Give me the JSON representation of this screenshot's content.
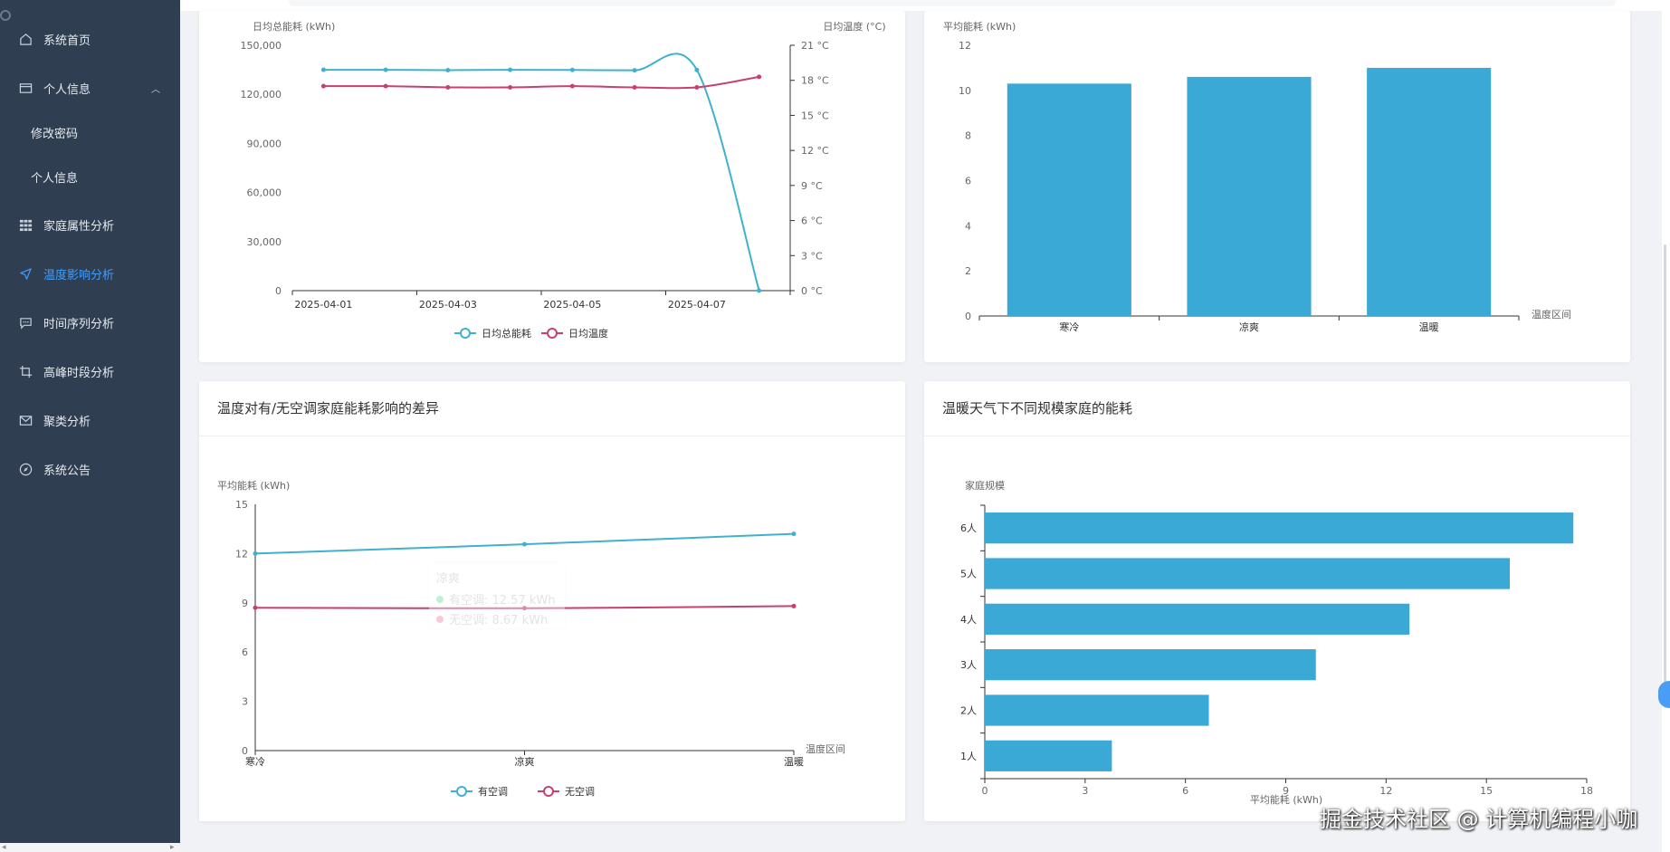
{
  "sidebar": {
    "items": [
      {
        "label": "系统首页",
        "icon": "home-icon"
      },
      {
        "label": "个人信息",
        "icon": "wallet-icon"
      },
      {
        "label": "修改密码"
      },
      {
        "label": "个人信息"
      },
      {
        "label": "家庭属性分析",
        "icon": "grid-icon"
      },
      {
        "label": "温度影响分析",
        "icon": "send-icon"
      },
      {
        "label": "时间序列分析",
        "icon": "chat-icon"
      },
      {
        "label": "高峰时段分析",
        "icon": "crop-icon"
      },
      {
        "label": "聚类分析",
        "icon": "mail-icon"
      },
      {
        "label": "系统公告",
        "icon": "compass-icon"
      }
    ],
    "active_color": "#409eff"
  },
  "cards": {
    "bottom_left_title": "温度对有/无空调家庭能耗影响的差异",
    "bottom_right_title": "温暖天气下不同规模家庭的能耗"
  },
  "tooltip": {
    "title": "凉爽",
    "row1": "有空调: 12.57 kWh",
    "row2": "无空调: 8.67 kWh"
  },
  "watermark": "掘金技术社区 @ 计算机编程小咖",
  "chart_data": [
    {
      "type": "line",
      "x": [
        "2025-04-01",
        "2025-04-02",
        "2025-04-03",
        "2025-04-04",
        "2025-04-05",
        "2025-04-06",
        "2025-04-07",
        "2025-04-08"
      ],
      "xtick_labels": [
        "2025-04-01",
        "2025-04-03",
        "2025-04-05",
        "2025-04-07"
      ],
      "series": [
        {
          "name": "日均总能耗",
          "axis": "left",
          "color": "#3fb1ce",
          "values": [
            135000,
            135000,
            134800,
            135000,
            134900,
            134700,
            134900,
            0
          ]
        },
        {
          "name": "日均温度",
          "axis": "right",
          "color": "#c8416a",
          "values": [
            17.5,
            17.5,
            17.4,
            17.4,
            17.5,
            17.4,
            17.4,
            18.3
          ]
        }
      ],
      "ylabel": "日均总能耗 (kWh)",
      "y2label": "日均温度 (°C)",
      "ylim": [
        0,
        150000
      ],
      "yticks": [
        "0",
        "30,000",
        "60,000",
        "90,000",
        "120,000",
        "150,000"
      ],
      "y2lim": [
        0,
        21
      ],
      "y2ticks": [
        "0 °C",
        "3 °C",
        "6 °C",
        "9 °C",
        "12 °C",
        "15 °C",
        "18 °C",
        "21 °C"
      ],
      "legend": "bottom"
    },
    {
      "type": "bar",
      "categories": [
        "寒冷",
        "凉爽",
        "温暖"
      ],
      "values": [
        10.3,
        10.6,
        11.0
      ],
      "color": "#3aa9d6",
      "ylabel": "平均能耗 (kWh)",
      "xlabel": "温度区间",
      "ylim": [
        0,
        12
      ],
      "yticks": [
        "0",
        "2",
        "4",
        "6",
        "8",
        "10",
        "12"
      ]
    },
    {
      "type": "line",
      "categories": [
        "寒冷",
        "凉爽",
        "温暖"
      ],
      "series": [
        {
          "name": "有空调",
          "color": "#3fb1ce",
          "values": [
            12.0,
            12.57,
            13.2
          ]
        },
        {
          "name": "无空调",
          "color": "#c8416a",
          "values": [
            8.7,
            8.67,
            8.8
          ]
        }
      ],
      "ylabel": "平均能耗 (kWh)",
      "xlabel": "温度区间",
      "ylim": [
        0,
        15
      ],
      "yticks": [
        "0",
        "3",
        "6",
        "9",
        "12",
        "15"
      ],
      "legend": "bottom"
    },
    {
      "type": "bar",
      "orientation": "horizontal",
      "categories": [
        "1人",
        "2人",
        "3人",
        "4人",
        "5人",
        "6人"
      ],
      "values": [
        3.8,
        6.7,
        9.9,
        12.7,
        15.7,
        17.6
      ],
      "color": "#3aa9d6",
      "ylabel": "家庭规模",
      "xlabel": "平均能耗 (kWh)",
      "xlim": [
        0,
        18
      ],
      "xticks": [
        "0",
        "3",
        "6",
        "9",
        "12",
        "15",
        "18"
      ]
    }
  ]
}
